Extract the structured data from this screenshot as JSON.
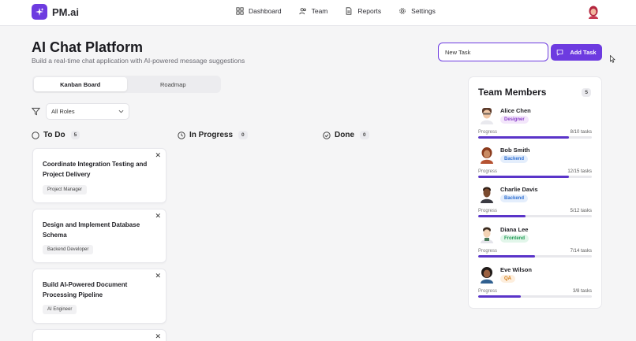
{
  "app": {
    "name": "PM.ai"
  },
  "nav": [
    {
      "label": "Dashboard",
      "icon": "grid-icon"
    },
    {
      "label": "Team",
      "icon": "users-icon"
    },
    {
      "label": "Reports",
      "icon": "document-icon"
    },
    {
      "label": "Settings",
      "icon": "gear-icon"
    }
  ],
  "header": {
    "title": "AI Chat Platform",
    "subtitle": "Build a real-time chat application with AI-powered message suggestions"
  },
  "task_input": {
    "value": "New Task"
  },
  "add_button": {
    "label": "Add Task"
  },
  "tabs": [
    {
      "label": "Kanban Board",
      "active": true
    },
    {
      "label": "Roadmap",
      "active": false
    }
  ],
  "filter": {
    "selected": "All Roles"
  },
  "columns": [
    {
      "title": "To Do",
      "count": "5"
    },
    {
      "title": "In Progress",
      "count": "0"
    },
    {
      "title": "Done",
      "count": "0"
    }
  ],
  "tasks": [
    {
      "title": "Coordinate Integration Testing and Project Delivery",
      "tag": "Project Manager"
    },
    {
      "title": "Design and Implement Database Schema",
      "tag": "Backend Developer"
    },
    {
      "title": "Build AI-Powered Document Processing Pipeline",
      "tag": "AI Engineer"
    }
  ],
  "team": {
    "title": "Team Members",
    "count": "5",
    "progress_label": "Progress",
    "members": [
      {
        "name": "Alice Chen",
        "role": "Designer",
        "progress": "8/10 tasks",
        "fraction": 0.8,
        "role_color": "#8b3fc9",
        "role_bg": "#f3e6fb"
      },
      {
        "name": "Bob Smith",
        "role": "Backend",
        "progress": "12/15 tasks",
        "fraction": 0.8,
        "role_color": "#2f6fd1",
        "role_bg": "#e4eefc"
      },
      {
        "name": "Charlie Davis",
        "role": "Backend",
        "progress": "5/12 tasks",
        "fraction": 0.4167,
        "role_color": "#2f6fd1",
        "role_bg": "#e4eefc"
      },
      {
        "name": "Diana Lee",
        "role": "Frontend",
        "progress": "7/14 tasks",
        "fraction": 0.5,
        "role_color": "#1f9a53",
        "role_bg": "#e2f6ea"
      },
      {
        "name": "Eve Wilson",
        "role": "QA",
        "progress": "3/8 tasks",
        "fraction": 0.375,
        "role_color": "#d07a12",
        "role_bg": "#fdeedd"
      }
    ]
  },
  "colors": {
    "accent": "#6d3be0",
    "progress": "#5a34c9"
  }
}
